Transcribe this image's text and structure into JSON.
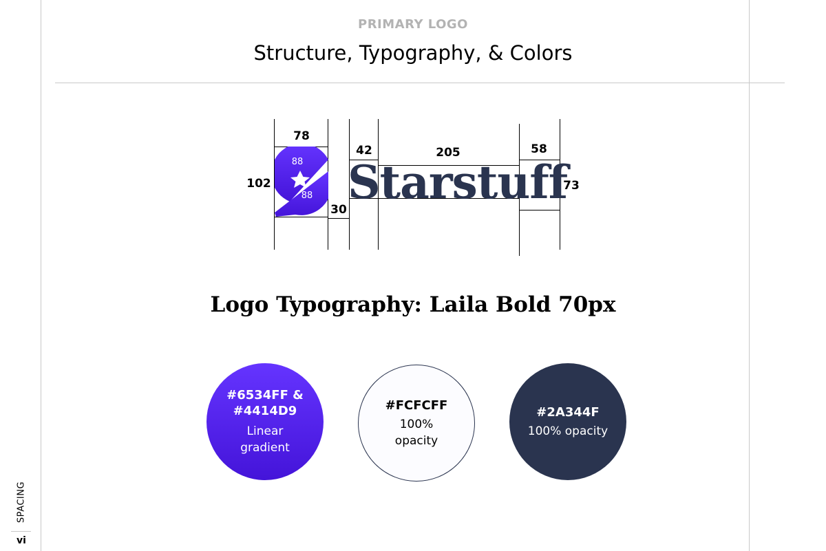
{
  "header": {
    "eyebrow": "PRIMARY LOGO",
    "title": "Structure, Typography, & Colors"
  },
  "logo": {
    "wordmark": "Starstuff",
    "icon": "star-icon",
    "icon_labels": [
      "88",
      "88"
    ],
    "dimensions": {
      "mark_width": "78",
      "mark_height": "102",
      "gap": "30",
      "cap_height": "42",
      "word_width": "205",
      "ff_width": "58",
      "ff_height": "73"
    }
  },
  "typography": {
    "heading": "Logo Typography: Laila Bold 70px"
  },
  "colors": [
    {
      "hex": "#6534FF &\n#4414D9",
      "hex_line1": "#6534FF &",
      "hex_line2": "#4414D9",
      "desc_line1": "Linear",
      "desc_line2": "gradient"
    },
    {
      "hex_line1": "#FCFCFF",
      "desc_line1": "100%",
      "desc_line2": "opacity"
    },
    {
      "hex_line1": "#2A344F",
      "desc_line1": "100% opacity"
    }
  ],
  "palette": {
    "gradient_start": "#6534FF",
    "gradient_end": "#4414D9",
    "light": "#FCFCFF",
    "dark": "#2A344F"
  },
  "sidebar": {
    "section": "SPACING",
    "page": "vi"
  }
}
